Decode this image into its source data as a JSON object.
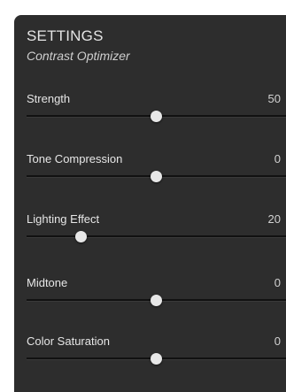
{
  "header": {
    "title": "SETTINGS",
    "subtitle": "Contrast Optimizer"
  },
  "sliders": [
    {
      "label": "Strength",
      "value": "50",
      "position": 0.5
    },
    {
      "label": "Tone Compression",
      "value": "0",
      "position": 0.5
    },
    {
      "label": "Lighting Effect",
      "value": "20",
      "position": 0.21
    },
    {
      "label": "Midtone",
      "value": "0",
      "position": 0.5
    },
    {
      "label": "Color Saturation",
      "value": "0",
      "position": 0.5
    }
  ]
}
